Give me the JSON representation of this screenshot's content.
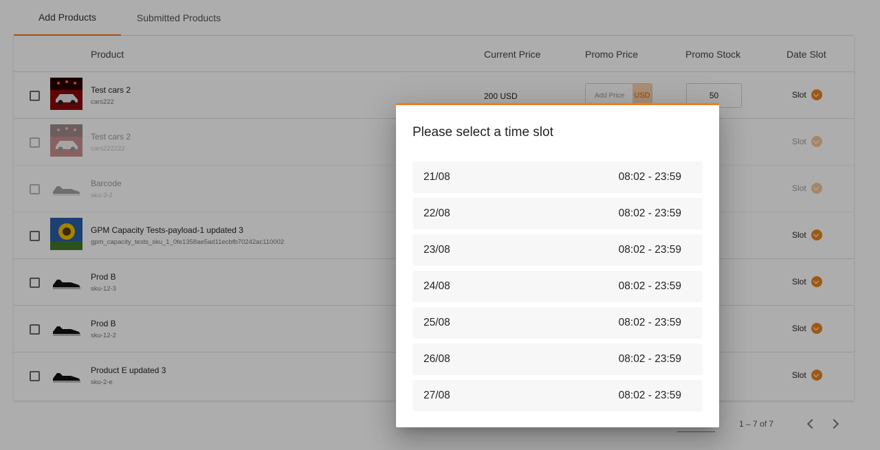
{
  "tabs": {
    "add": "Add Products",
    "submitted": "Submitted Products"
  },
  "table_header": {
    "product": "Product",
    "current_price": "Current Price",
    "promo_price": "Promo Price",
    "promo_stock": "Promo Stock",
    "date_slot": "Date Slot"
  },
  "rows": [
    {
      "name": "Test cars 2",
      "sku": "cars222",
      "current_price": "200 USD",
      "price_placeholder": "Add Price",
      "currency": "USD",
      "stock": "50",
      "slot": "Slot"
    },
    {
      "name": "Test cars 2",
      "sku": "cars222222",
      "slot": "Slot"
    },
    {
      "name": "Barcode",
      "sku": "sku-3-2",
      "slot": "Slot"
    },
    {
      "name": "GPM Capacity Tests-payload-1 updated 3",
      "sku": "gpm_capacity_tests_sku_1_0fe1358ae5ad11ecbfb70242ac110002",
      "slot": "Slot"
    },
    {
      "name": "Prod B",
      "sku": "sku-12-3",
      "slot": "Slot"
    },
    {
      "name": "Prod B",
      "sku": "sku-12-2",
      "slot": "Slot"
    },
    {
      "name": "Product E updated 3",
      "sku": "sku-2-e",
      "slot": "Slot"
    }
  ],
  "pagination": {
    "range": "1 – 7 of 7"
  },
  "modal": {
    "title": "Please select a time slot",
    "slots": [
      {
        "date": "21/08",
        "time": "08:02 - 23:59"
      },
      {
        "date": "22/08",
        "time": "08:02 - 23:59"
      },
      {
        "date": "23/08",
        "time": "08:02 - 23:59"
      },
      {
        "date": "24/08",
        "time": "08:02 - 23:59"
      },
      {
        "date": "25/08",
        "time": "08:02 - 23:59"
      },
      {
        "date": "26/08",
        "time": "08:02 - 23:59"
      },
      {
        "date": "27/08",
        "time": "08:02 - 23:59"
      }
    ]
  },
  "colors": {
    "accent": "#f07c1b",
    "slot_chevron": "#e7831d",
    "currency_bg": "#fbd2ad"
  }
}
